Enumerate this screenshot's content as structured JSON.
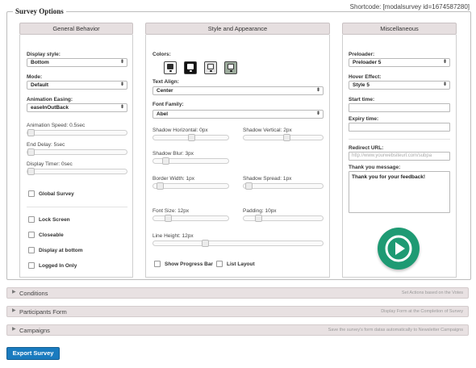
{
  "shortcode": "Shortcode: [modalsurvey id=1674587280]",
  "legend": "Survey Options",
  "columns": {
    "general": "General Behavior",
    "style": "Style and Appearance",
    "misc": "Miscellaneous"
  },
  "general": {
    "display_style_label": "Display style:",
    "display_style_value": "Bottom",
    "mode_label": "Mode:",
    "mode_value": "Default",
    "easing_label": "Animation Easing:",
    "easing_value": "easeInOutBack",
    "anim_speed_label": "Animation Speed: 0.5sec",
    "end_delay_label": "End Delay: 5sec",
    "display_timer_label": "Display Timer: 0sec",
    "global_survey": "Global Survey",
    "lock_screen": "Lock Screen",
    "closeable": "Closeable",
    "display_at_bottom": "Display at bottom",
    "logged_in_only": "Logged In Only"
  },
  "style": {
    "colors_label": "Colors:",
    "swatch_colors": [
      {
        "bg": "#ffffff",
        "inner": "#2b2b2b"
      },
      {
        "bg": "#111111",
        "inner": "#ffffff"
      },
      {
        "bg": "#e2e2e2",
        "inner": "#ffffff"
      },
      {
        "bg": "#9dac9d",
        "inner": "#ffffff"
      }
    ],
    "text_align_label": "Text Align:",
    "text_align_value": "Center",
    "font_family_label": "Font Family:",
    "font_family_value": "Abel",
    "shadow_h_label": "Shadow Horizontal: 0px",
    "shadow_v_label": "Shadow Vertical: 2px",
    "shadow_blur_label": "Shadow Blur: 3px",
    "border_width_label": "Border Width: 1px",
    "shadow_spread_label": "Shadow Spread: 1px",
    "font_size_label": "Font Size: 12px",
    "padding_label": "Padding: 10px",
    "line_height_label": "Line Height: 12px",
    "show_progress_bar": "Show Progress Bar",
    "list_layout": "List Layout"
  },
  "misc": {
    "preloader_label": "Preloader:",
    "preloader_value": "Preloader 5",
    "hover_label": "Hover Effect:",
    "hover_value": "Style 5",
    "start_time_label": "Start time:",
    "expiry_time_label": "Expiry time:",
    "redirect_label": "Redirect URL:",
    "redirect_placeholder": "http://www.yourwebsiteurl.com/subpa",
    "thank_you_label": "Thank you message:",
    "thank_you_value": "Thank you for your feedback!"
  },
  "accordions": [
    {
      "title": "Conditions",
      "hint": "Set Actions based on the Votes"
    },
    {
      "title": "Participants Form",
      "hint": "Display Form at the Completion of Survey"
    },
    {
      "title": "Campaigns",
      "hint": "Save the survey's form datas automatically to Newsletter Campaigns"
    }
  ],
  "export_button": "Export Survey",
  "accent_color": "#1e9a73"
}
